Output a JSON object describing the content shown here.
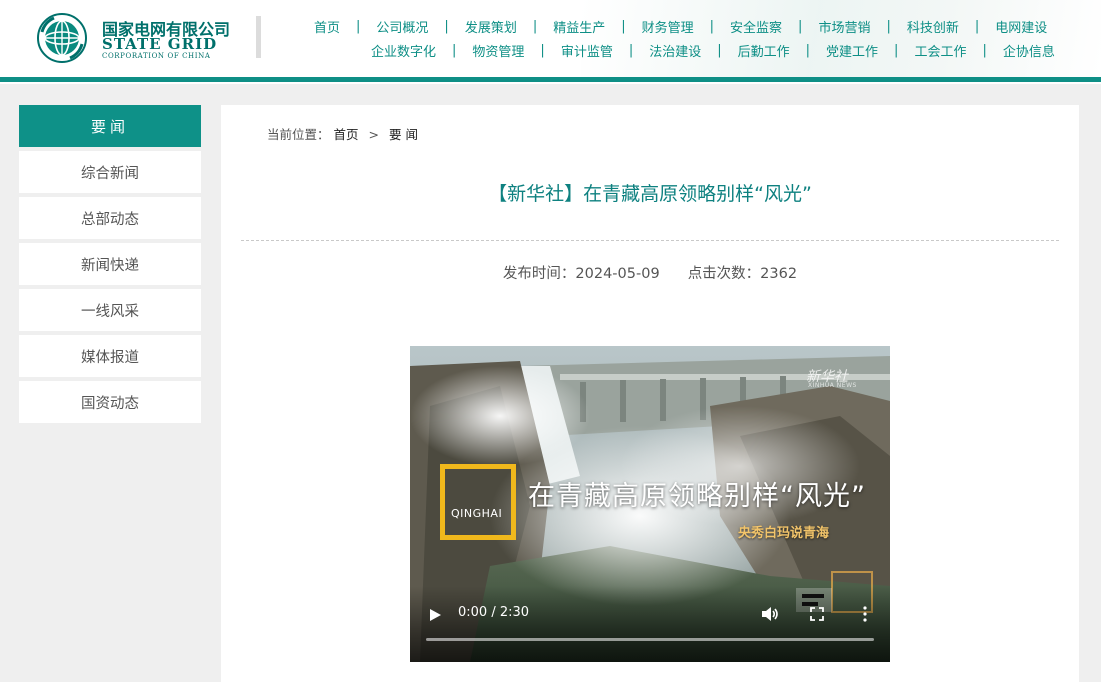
{
  "header": {
    "logo": {
      "name_cn": "国家电网有限公司",
      "name_en": "STATE GRID",
      "name_en_sub": "CORPORATION OF CHINA"
    },
    "nav_row1": [
      "首页",
      "公司概况",
      "发展策划",
      "精益生产",
      "财务管理",
      "安全监察",
      "市场营销",
      "科技创新",
      "电网建设"
    ],
    "nav_row2": [
      "企业数字化",
      "物资管理",
      "审计监管",
      "法治建设",
      "后勤工作",
      "党建工作",
      "工会工作",
      "企协信息"
    ],
    "separator": "|"
  },
  "sidebar": {
    "title": "要闻",
    "items": [
      "综合新闻",
      "总部动态",
      "新闻快递",
      "一线风采",
      "媒体报道",
      "国资动态"
    ]
  },
  "breadcrumb": {
    "label": "当前位置：",
    "home": "首页",
    "sep": ">",
    "current": "要 闻"
  },
  "article": {
    "title": "【新华社】在青藏高原领略别样“风光”",
    "publish_label": "发布时间：2024-05-09",
    "views_label": "点击次数：2362"
  },
  "video": {
    "headline": "在青藏高原领略别样“风光”",
    "subline": "央秀白玛说青海",
    "box_text": "QINGHAI",
    "watermark": "新华社",
    "watermark_sub": "XINHUA NEWS",
    "time": "0:00 / 2:30",
    "progress": 0
  },
  "icons": {
    "logo": "state-grid-globe-icon",
    "play": "play-icon",
    "volume": "volume-icon",
    "fullscreen": "fullscreen-icon",
    "more": "more-vertical-icon"
  },
  "colors": {
    "brand": "#0e8f86",
    "brand_dark": "#00706b",
    "title": "#0e8180",
    "page_bg": "#efefef",
    "accent_yellow": "#f0b81c"
  }
}
